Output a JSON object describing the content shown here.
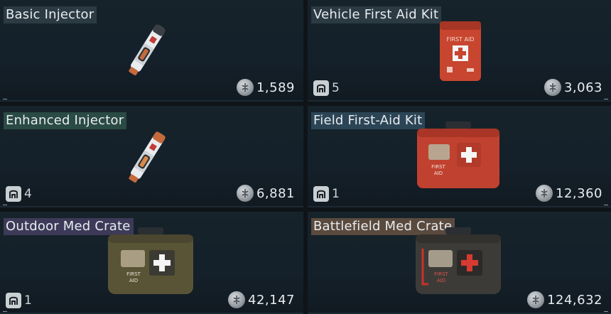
{
  "items": [
    {
      "name": "Basic Injector",
      "price": "1,589",
      "limit": null,
      "title_bg": "#2b3a43"
    },
    {
      "name": "Vehicle First Aid Kit",
      "price": "3,063",
      "limit": "5",
      "title_bg": "#2b3a43"
    },
    {
      "name": "Enhanced Injector",
      "price": "6,881",
      "limit": "4",
      "title_bg": "#2a4a44"
    },
    {
      "name": "Field First-Aid Kit",
      "price": "12,360",
      "limit": "1",
      "title_bg": "#2c4556"
    },
    {
      "name": "Outdoor Med Crate",
      "price": "42,147",
      "limit": "1",
      "title_bg": "#3d3a59"
    },
    {
      "name": "Battlefield Med Crate",
      "price": "124,632",
      "limit": null,
      "title_bg": "#5a4a3e"
    }
  ],
  "icons": {
    "currency": "coin-icon",
    "limit": "purchase-limit-icon"
  },
  "art_labels": {
    "first": "FIRST",
    "aid": "AID",
    "first_aid": "FIRST AID"
  }
}
